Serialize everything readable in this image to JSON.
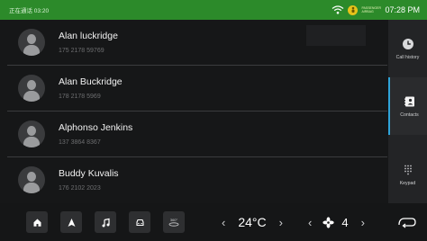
{
  "status_bar": {
    "call_status": "正在通话 03:20",
    "time": "07:28 PM",
    "pass_label": "PASSENGER AIRBAG"
  },
  "contacts": [
    {
      "name": "Alan luckridge",
      "phone": "175 2178 59769"
    },
    {
      "name": "Alan Buckridge",
      "phone": "178 2178 5969"
    },
    {
      "name": "Alphonso Jenkins",
      "phone": "137 3864 8367"
    },
    {
      "name": "Buddy Kuvalis",
      "phone": "176 2102 2023"
    }
  ],
  "sidebar": {
    "tabs": [
      {
        "label": "Call history",
        "icon": "clock-icon",
        "active": false
      },
      {
        "label": "Contacts",
        "icon": "contacts-icon",
        "active": true
      },
      {
        "label": "Keypad",
        "icon": "keypad-icon",
        "active": false
      }
    ]
  },
  "bottom_bar": {
    "temperature": "24°C",
    "fan_level": "4",
    "camera_label": "360°",
    "accent_color": "#2fa4d8",
    "status_color": "#2c8a2a"
  }
}
